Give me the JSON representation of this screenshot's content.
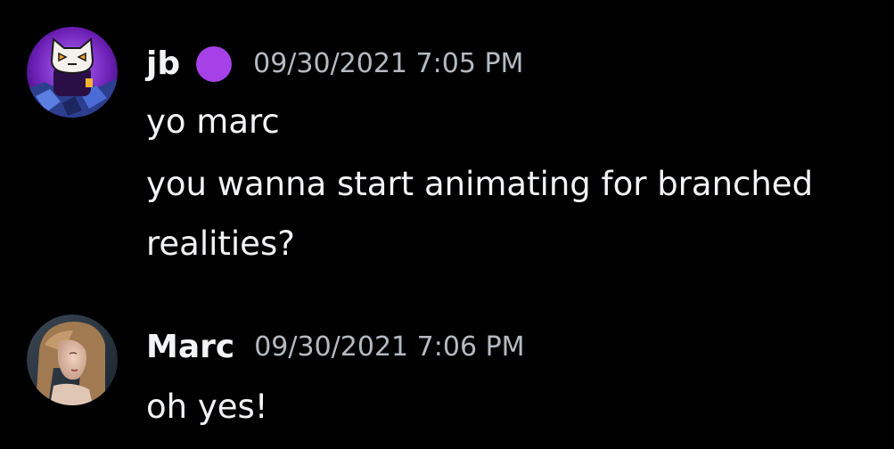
{
  "colors": {
    "background": "#000000",
    "text": "#f2f3f5",
    "timestamp": "#b5bac1",
    "badge": "#a641e8"
  },
  "messages": [
    {
      "author": "jb",
      "badge_icon": "purple-circle-emoji",
      "timestamp": "09/30/2021 7:05 PM",
      "avatar_icon": "purple-cat-character-avatar",
      "lines": [
        "yo marc",
        "you wanna start animating for branched",
        "realities?"
      ]
    },
    {
      "author": "Marc",
      "timestamp": "09/30/2021 7:06 PM",
      "avatar_icon": "portrait-photo-avatar",
      "lines": [
        "oh yes!"
      ]
    }
  ]
}
